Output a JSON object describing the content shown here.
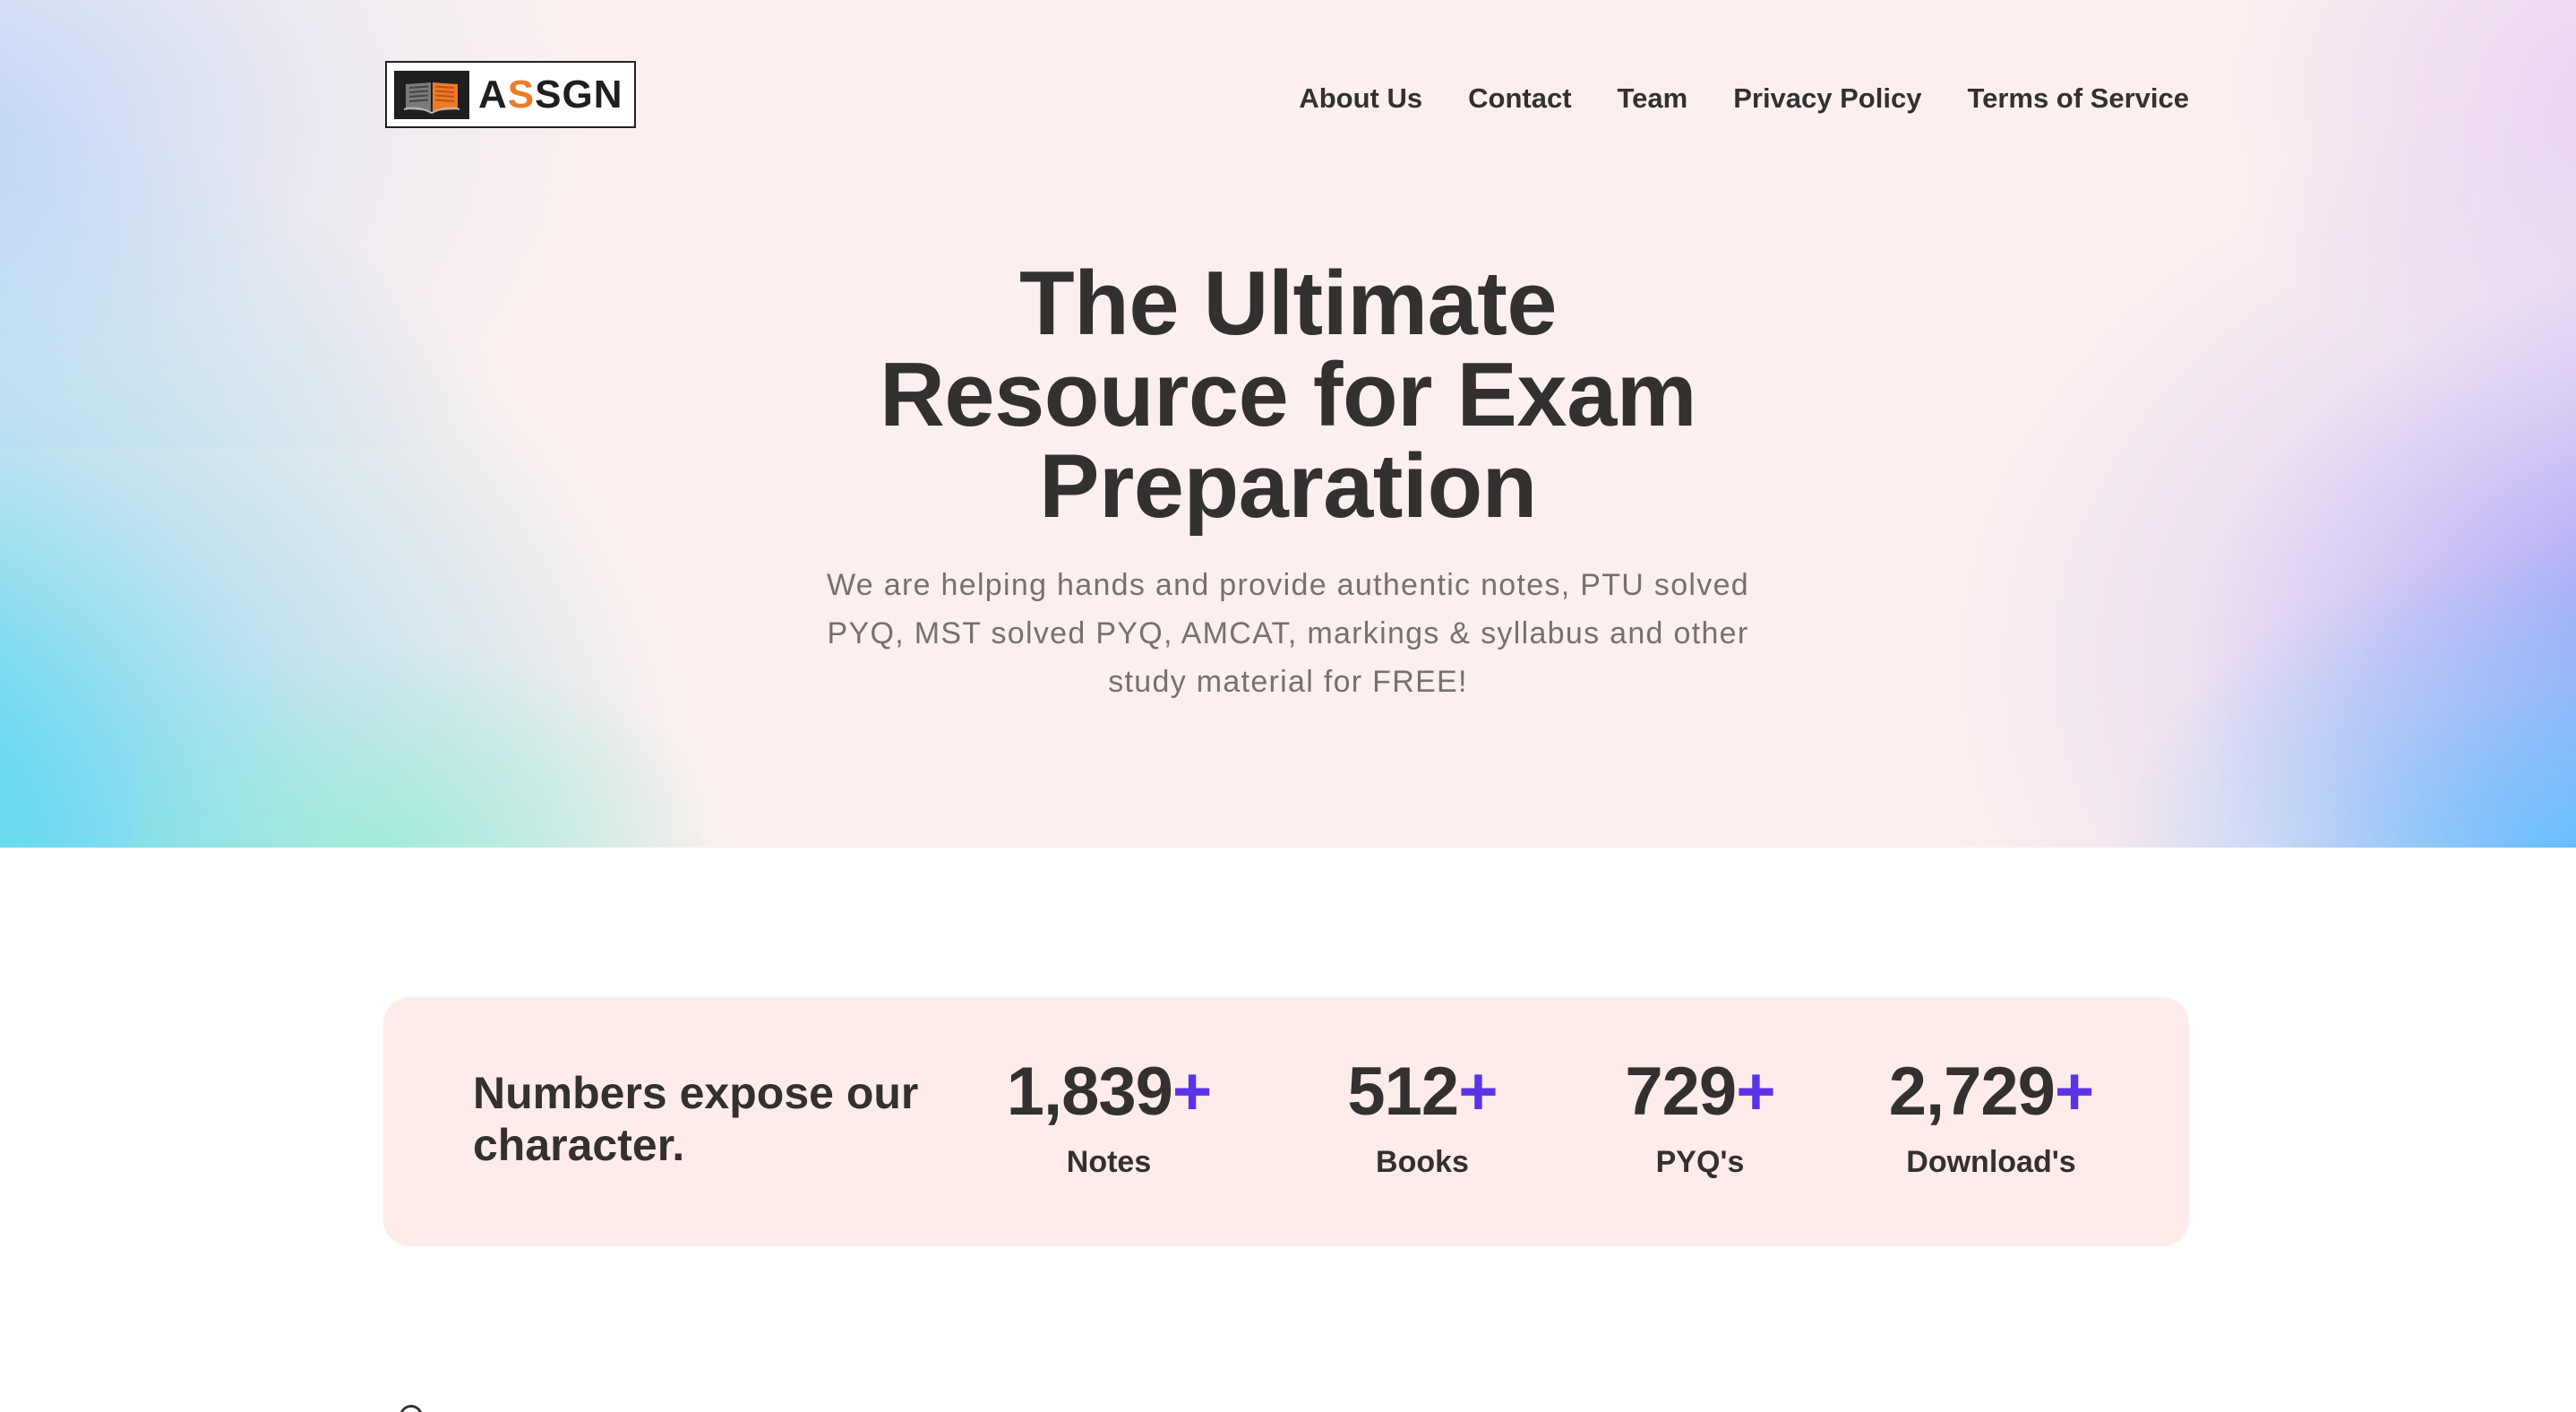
{
  "brand": {
    "logo_icon": "open-book-icon",
    "name_prefix": "A",
    "name_accent": "S",
    "name_suffix": "SGN",
    "accent_color": "#ef7a26"
  },
  "nav": {
    "items": [
      {
        "label": "About Us"
      },
      {
        "label": "Contact"
      },
      {
        "label": "Team"
      },
      {
        "label": "Privacy Policy"
      },
      {
        "label": "Terms of Service"
      }
    ]
  },
  "hero": {
    "headline_line1": "The Ultimate",
    "headline_line2": "Resource for Exam",
    "headline_line3": "Preparation",
    "subtext": "We are helping hands and provide authentic notes, PTU solved PYQ, MST solved PYQ, AMCAT, markings & syllabus and other study material for FREE!"
  },
  "stats": {
    "heading": "Numbers expose our character.",
    "plus_color": "#5a33e6",
    "items": [
      {
        "value": "1,839",
        "suffix": "+",
        "label": "Notes"
      },
      {
        "value": "512",
        "suffix": "+",
        "label": "Books"
      },
      {
        "value": "729",
        "suffix": "+",
        "label": "PYQ's"
      },
      {
        "value": "2,729",
        "suffix": "+",
        "label": "Download's"
      }
    ]
  }
}
